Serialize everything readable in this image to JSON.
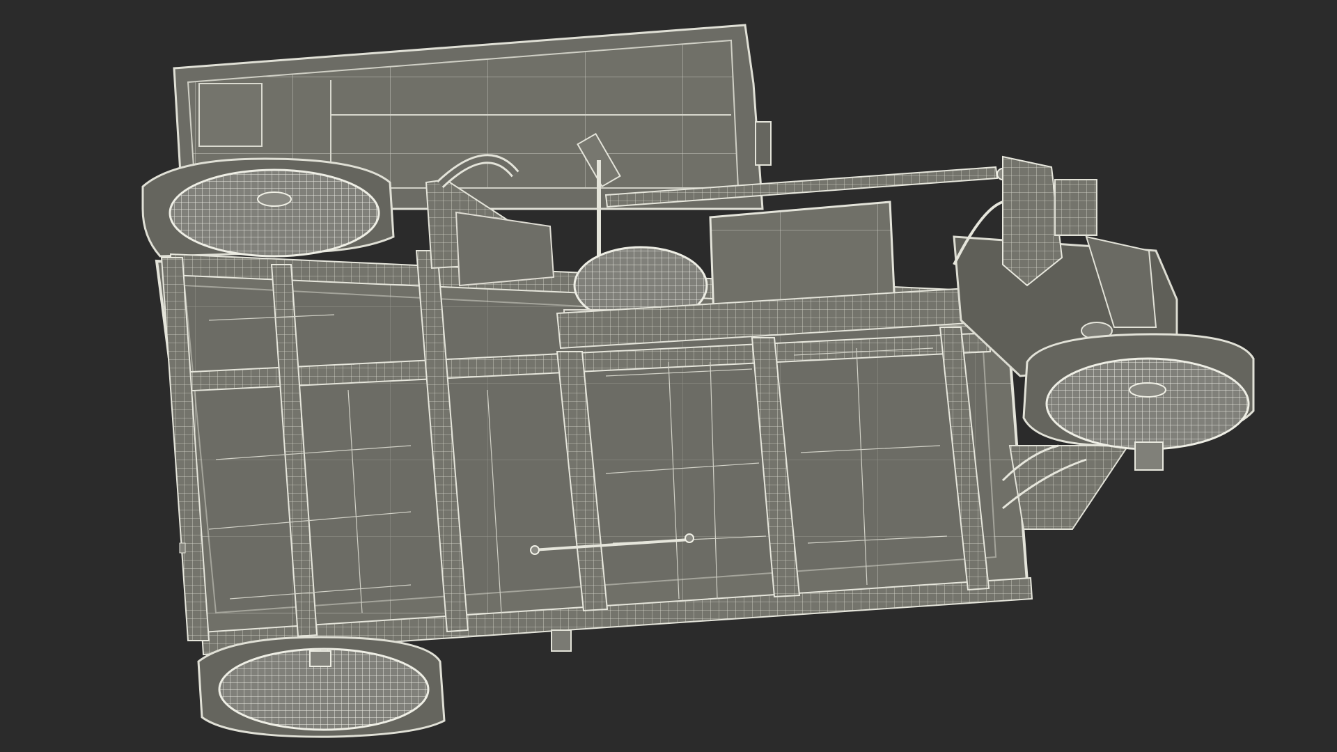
{
  "scene": {
    "background_color": "#2b2b2b",
    "model_fill_color": "#6f6f66",
    "model_dark_fill_color": "#5f5f58",
    "wire_color": "#d9d9cf",
    "edge_color": "#e8e8df",
    "subject": "wireframe-utility-tricycle-underside"
  }
}
